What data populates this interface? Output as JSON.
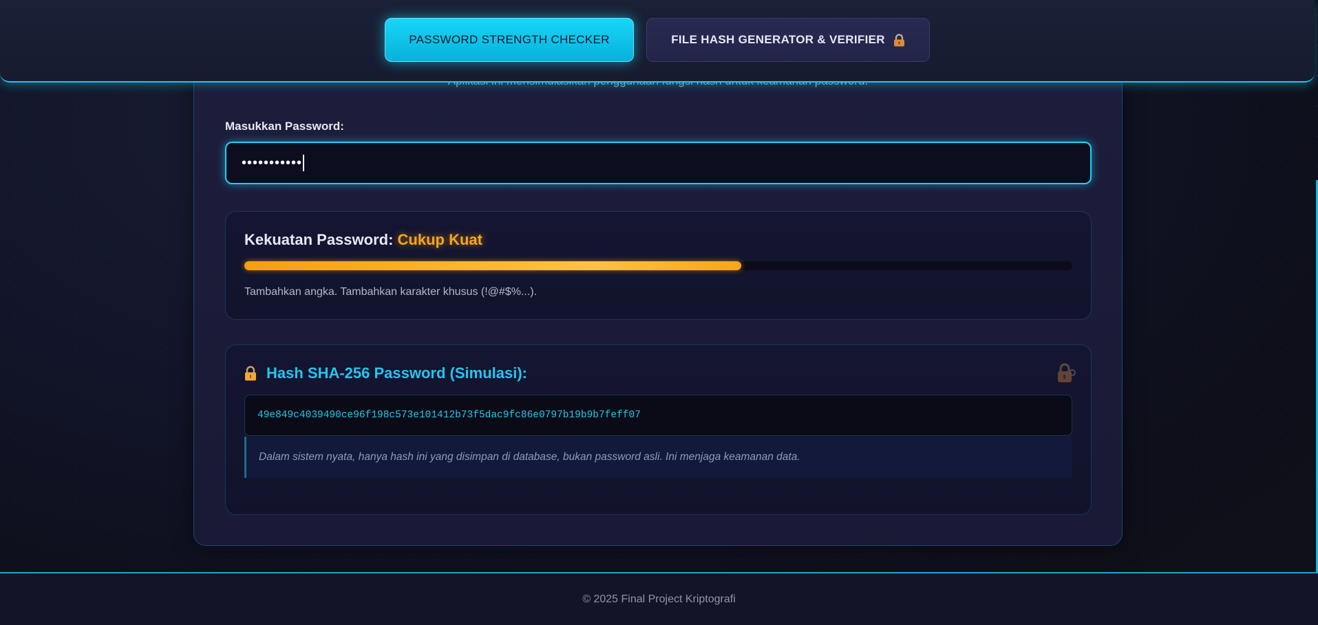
{
  "nav": {
    "tabs": [
      {
        "label": "PASSWORD STRENGTH CHECKER",
        "active": true
      },
      {
        "label": "FILE HASH GENERATOR & VERIFIER",
        "icon": "lock-icon",
        "active": false
      }
    ]
  },
  "main": {
    "subtitle": "Aplikasi ini mensimulasikan penggunaan fungsi hash untuk keamanan password.",
    "password": {
      "label": "Masukkan Password:",
      "value": "•••••••••••"
    },
    "strength": {
      "label": "Kekuatan Password:",
      "level": "Cukup Kuat",
      "progress_percent": 60,
      "hint": "Tambahkan angka. Tambahkan karakter khusus (!@#$%...).",
      "color": "#f9a51c"
    },
    "hash": {
      "icon": "lock-icon",
      "title": "Hash SHA-256 Password (Simulasi):",
      "value": "49e849c4039490ce96f198c573e101412b73f5dac9fc86e0797b19b9b7feff07",
      "note": "Dalam sistem nyata, hanya hash ini yang disimpan di database, bukan password asli. Ini menjaga keamanan data."
    }
  },
  "footer": {
    "text": "© 2025 Final Project Kriptografi"
  },
  "colors": {
    "accent": "#17d4f5",
    "warning": "#f9a51c",
    "background": "#12152a"
  }
}
